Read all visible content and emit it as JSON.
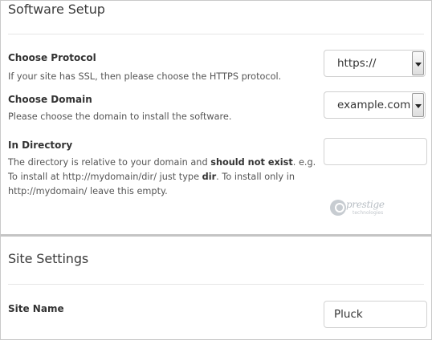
{
  "software_setup": {
    "title": "Software Setup",
    "protocol": {
      "label": "Choose Protocol",
      "help": "If your site has SSL, then please choose the HTTPS protocol.",
      "value": "https://"
    },
    "domain": {
      "label": "Choose Domain",
      "help": "Please choose the domain to install the software.",
      "value": "example.com"
    },
    "directory": {
      "label": "In Directory",
      "help_part1": "The directory is relative to your domain and ",
      "help_bold1": "should not exist",
      "help_part2": ". e.g. To install at http://mydomain/dir/ just type ",
      "help_bold2": "dir",
      "help_part3": ". To install only in http://mydomain/ leave this empty.",
      "value": ""
    },
    "watermark": {
      "name": "prestige",
      "tagline": "technologies"
    }
  },
  "site_settings": {
    "title": "Site Settings",
    "site_name": {
      "label": "Site Name",
      "value": "Pluck"
    }
  }
}
